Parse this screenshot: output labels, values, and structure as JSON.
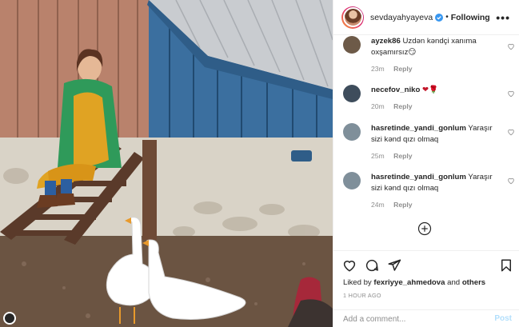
{
  "post": {
    "owner": "sevdayahyayeva",
    "follow_label": "Following",
    "separator": "•",
    "more_label": "•••",
    "liked_by_prefix": "Liked by ",
    "liked_by_user": "fexriyye_ahmedova",
    "liked_by_and": " and ",
    "liked_by_others": "others",
    "time": "1 HOUR AGO"
  },
  "comments": [
    {
      "user": "ayzek86",
      "text": "Uzdən kəndçi xanıma oxşamırsız😏",
      "time": "23m",
      "reply": "Reply",
      "avatar_color": "#6d5a48"
    },
    {
      "user": "necefov_niko",
      "text": "❤🌹",
      "time": "20m",
      "reply": "Reply",
      "avatar_color": "#3e4d5c"
    },
    {
      "user": "hasretinde_yandi_gonlum",
      "text": "Yaraşır sizi kənd qızı olmaq",
      "time": "25m",
      "reply": "Reply",
      "avatar_color": "#7f8f9a"
    },
    {
      "user": "hasretinde_yandi_gonlum",
      "text": "Yaraşır sizi kənd qızı olmaq",
      "time": "24m",
      "reply": "Reply",
      "avatar_color": "#7f8f9a"
    }
  ],
  "input": {
    "placeholder": "Add a comment...",
    "post_label": "Post"
  },
  "icons": {
    "verified": "verified-badge-icon",
    "more": "more-options-icon",
    "heart": "heart-icon",
    "comment": "comment-icon",
    "share": "share-icon",
    "bookmark": "bookmark-icon",
    "load_more": "plus-circle-icon"
  },
  "colors": {
    "verified_blue": "#3897f0",
    "post_button_disabled": "#b2dffc",
    "meta_gray": "#8e8e8e",
    "text": "#262626"
  }
}
